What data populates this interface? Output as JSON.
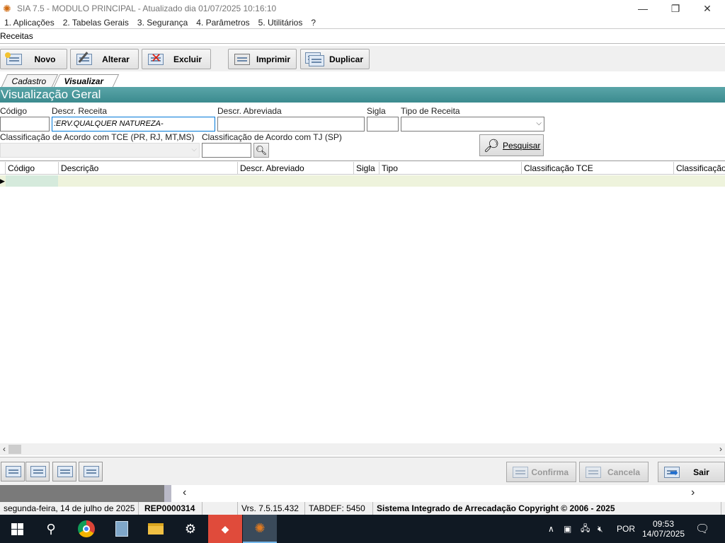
{
  "window": {
    "title": "SIA 7.5 - MODULO PRINCIPAL - Atualizado dia 01/07/2025 10:16:10",
    "minimize_glyph": "—",
    "restore_glyph": "❐",
    "close_glyph": "✕"
  },
  "menu": [
    "1. Aplicações",
    "2. Tabelas Gerais",
    "3. Segurança",
    "4. Parâmetros",
    "5. Utilitários",
    "?"
  ],
  "form_title": "Receitas",
  "toolbar": {
    "novo": "Novo",
    "alterar": "Alterar",
    "excluir": "Excluir",
    "imprimir": "Imprimir",
    "duplicar": "Duplicar"
  },
  "tabs": {
    "cadastro": "Cadastro",
    "visualizar": "Visualizar"
  },
  "section_title": "Visualização Geral",
  "filters": {
    "codigo_label": "Código",
    "codigo_value": "",
    "descr_receita_label": "Descr. Receita",
    "descr_receita_value": ":ERV.QUALQUER NATUREZA-",
    "descr_abreviada_label": "Descr. Abreviada",
    "descr_abreviada_value": "",
    "sigla_label": "Sigla",
    "sigla_value": "",
    "tipo_receita_label": "Tipo de Receita",
    "tipo_receita_value": "",
    "class_tce_label": "Classificação de Acordo com TCE (PR, RJ, MT,MS)",
    "class_tj_label": "Classificação de Acordo com TJ (SP)",
    "class_tj_value": "",
    "pesquisar": "Pesquisar"
  },
  "grid": {
    "columns": [
      "Código",
      "Descrição",
      "Descr. Abreviado",
      "Sigla",
      "Tipo",
      "Classificação TCE",
      "Classificação"
    ],
    "row_indicator": "▶"
  },
  "bottom": {
    "confirma": "Confirma",
    "cancela": "Cancela",
    "sair": "Sair"
  },
  "statusbar": {
    "date": "segunda-feira, 14 de julho de 2025",
    "report": "REP0000314",
    "version": "Vrs. 7.5.15.432",
    "tabdef": "TABDEF: 5450",
    "copyright": "Sistema Integrado de Arrecadação Copyright © 2006 - 2025"
  },
  "taskbar": {
    "language": "POR",
    "time": "09:53",
    "date": "14/07/2025"
  }
}
